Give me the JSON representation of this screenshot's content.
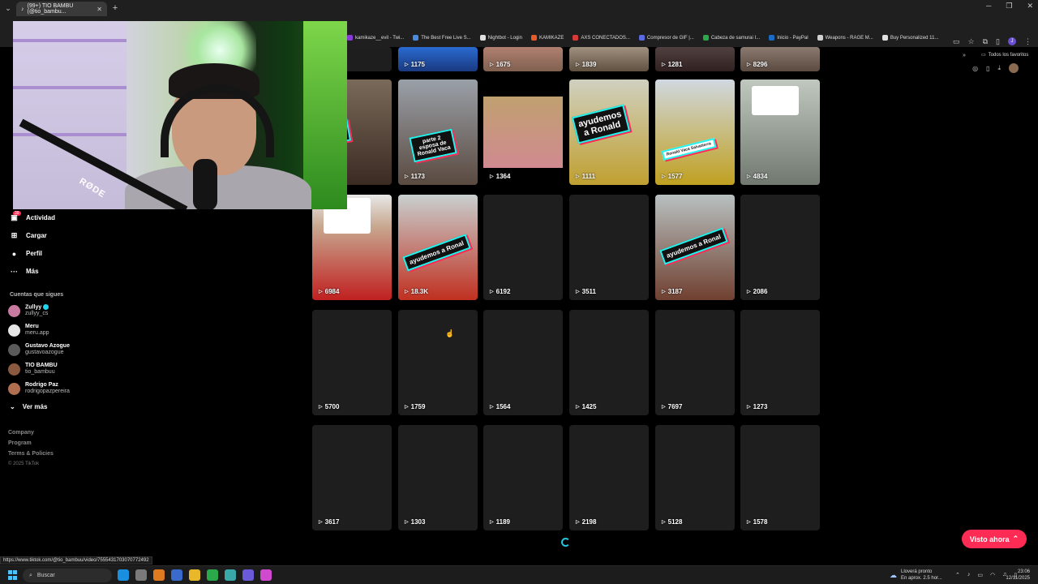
{
  "browser": {
    "tab_title": "(99+) TIO BAMBU (@tio_bambu...",
    "bookmarks": [
      "kamikaze__evil - Twi...",
      "The Best Free Live S...",
      "Nightbot - Login",
      "KAMIKAZE",
      "AXS CONECTADOS...",
      "Compresor de GIF |...",
      "Cabeza de samurai I...",
      "Inicio - PayPal",
      "Weapons - RAGE M...",
      "Buy Personalized 11..."
    ],
    "favorites_label": "Todos los favoritos",
    "profile_initial": "J",
    "status_url": "https://www.tiktok.com/@tio_bambuu/video/7555431703070772492"
  },
  "webcam": {
    "mic_brand": "RØDE"
  },
  "sidebar": {
    "activity_badge": "39",
    "nav": [
      {
        "label": "Actividad",
        "icon": "inbox-icon"
      },
      {
        "label": "Cargar",
        "icon": "upload-icon"
      },
      {
        "label": "Perfil",
        "icon": "profile-icon"
      },
      {
        "label": "Más",
        "icon": "more-icon"
      }
    ],
    "following_title": "Cuentas que sigues",
    "following": [
      {
        "name": "Zullyy",
        "user": "zullyy_cs",
        "verified": true
      },
      {
        "name": "Meru",
        "user": "meru.app"
      },
      {
        "name": "Gustavo Azogue",
        "user": "gustavoazogue"
      },
      {
        "name": "TIO BAMBU",
        "user": "tio_bambuu"
      },
      {
        "name": "Rodrigo Paz",
        "user": "rodrigopazpereira"
      }
    ],
    "see_more": "Ver más",
    "footer": [
      "Company",
      "Program",
      "Terms & Policies"
    ],
    "copyright": "© 2025 TikTok"
  },
  "grid": {
    "row0": [
      "",
      "1175",
      "1675",
      "1839",
      "1281",
      "8296"
    ],
    "row1": [
      "",
      "1173",
      "1364",
      "1111",
      "1577",
      "4834"
    ],
    "row2": [
      "6984",
      "18.3K",
      "6192",
      "3511",
      "3187",
      "2086"
    ],
    "row3": [
      "5700",
      "1759",
      "1564",
      "1425",
      "7697",
      "1273"
    ],
    "row4": [
      "3617",
      "1303",
      "1189",
      "2198",
      "5128",
      "1578"
    ],
    "captions": {
      "r1c0": "a de Ronal\nfinal",
      "r1c1": "parte 2\nesposa de\nRonald Vaca",
      "r1c3": "ayudemos\na Ronald",
      "r1c4": "Ronald Vaca Salvatierra",
      "r2c1": "ayudemos a Ronal",
      "r2c4": "ayudemos a Ronal"
    }
  },
  "cta": {
    "watch_now": "Visto ahora"
  },
  "taskbar": {
    "search": "Buscar",
    "weather_line1": "Lloverá pronto",
    "weather_line2": "En aprox. 2.5 hor...",
    "time": "23:06",
    "date": "12/11/2025"
  },
  "colors": {
    "accent": "#fe2c55",
    "cyan": "#25f4ee",
    "bg": "#000000"
  }
}
